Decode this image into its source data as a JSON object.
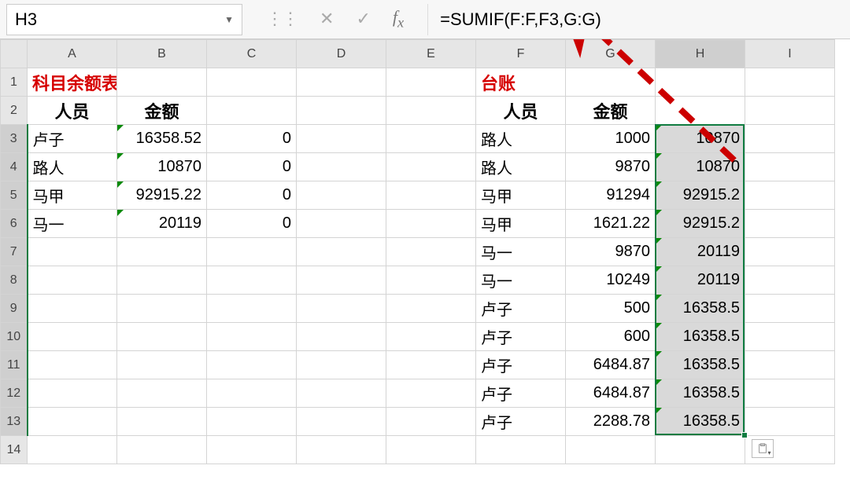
{
  "name_box": "H3",
  "formula": "=SUMIF(F:F,F3,G:G)",
  "columns": [
    "A",
    "B",
    "C",
    "D",
    "E",
    "F",
    "G",
    "H",
    "I"
  ],
  "rows": [
    "1",
    "2",
    "3",
    "4",
    "5",
    "6",
    "7",
    "8",
    "9",
    "10",
    "11",
    "12",
    "13",
    "14"
  ],
  "cells": {
    "A1": {
      "v": "科目余额表",
      "cls": "title-red left"
    },
    "F1": {
      "v": "台账",
      "cls": "title-red left"
    },
    "A2": {
      "v": "人员",
      "cls": "hdr-bold center"
    },
    "B2": {
      "v": "金额",
      "cls": "hdr-bold center"
    },
    "F2": {
      "v": "人员",
      "cls": "hdr-bold center"
    },
    "G2": {
      "v": "金额",
      "cls": "hdr-bold center"
    },
    "A3": {
      "v": "卢子",
      "cls": "left"
    },
    "B3": {
      "v": "16358.52",
      "cls": "right",
      "tri": true
    },
    "C3": {
      "v": "0",
      "cls": "right"
    },
    "F3": {
      "v": "路人",
      "cls": "left"
    },
    "G3": {
      "v": "1000",
      "cls": "right"
    },
    "H3": {
      "v": "10870",
      "cls": "right sel-col",
      "tri": true
    },
    "A4": {
      "v": "路人",
      "cls": "left"
    },
    "B4": {
      "v": "10870",
      "cls": "right",
      "tri": true
    },
    "C4": {
      "v": "0",
      "cls": "right"
    },
    "F4": {
      "v": "路人",
      "cls": "left"
    },
    "G4": {
      "v": "9870",
      "cls": "right"
    },
    "H4": {
      "v": "10870",
      "cls": "right sel-col",
      "tri": true
    },
    "A5": {
      "v": "马甲",
      "cls": "left"
    },
    "B5": {
      "v": "92915.22",
      "cls": "right",
      "tri": true
    },
    "C5": {
      "v": "0",
      "cls": "right"
    },
    "F5": {
      "v": "马甲",
      "cls": "left"
    },
    "G5": {
      "v": "91294",
      "cls": "right"
    },
    "H5": {
      "v": "92915.2",
      "cls": "right sel-col",
      "tri": true
    },
    "A6": {
      "v": "马一",
      "cls": "left"
    },
    "B6": {
      "v": "20119",
      "cls": "right",
      "tri": true
    },
    "C6": {
      "v": "0",
      "cls": "right"
    },
    "F6": {
      "v": "马甲",
      "cls": "left"
    },
    "G6": {
      "v": "1621.22",
      "cls": "right"
    },
    "H6": {
      "v": "92915.2",
      "cls": "right sel-col",
      "tri": true
    },
    "F7": {
      "v": "马一",
      "cls": "left"
    },
    "G7": {
      "v": "9870",
      "cls": "right"
    },
    "H7": {
      "v": "20119",
      "cls": "right sel-col",
      "tri": true
    },
    "F8": {
      "v": "马一",
      "cls": "left"
    },
    "G8": {
      "v": "10249",
      "cls": "right"
    },
    "H8": {
      "v": "20119",
      "cls": "right sel-col",
      "tri": true
    },
    "F9": {
      "v": "卢子",
      "cls": "left"
    },
    "G9": {
      "v": "500",
      "cls": "right"
    },
    "H9": {
      "v": "16358.5",
      "cls": "right sel-col",
      "tri": true
    },
    "F10": {
      "v": "卢子",
      "cls": "left"
    },
    "G10": {
      "v": "600",
      "cls": "right"
    },
    "H10": {
      "v": "16358.5",
      "cls": "right sel-col",
      "tri": true
    },
    "F11": {
      "v": "卢子",
      "cls": "left"
    },
    "G11": {
      "v": "6484.87",
      "cls": "right"
    },
    "H11": {
      "v": "16358.5",
      "cls": "right sel-col",
      "tri": true
    },
    "F12": {
      "v": "卢子",
      "cls": "left"
    },
    "G12": {
      "v": "6484.87",
      "cls": "right"
    },
    "H12": {
      "v": "16358.5",
      "cls": "right sel-col",
      "tri": true
    },
    "F13": {
      "v": "卢子",
      "cls": "left"
    },
    "G13": {
      "v": "2288.78",
      "cls": "right"
    },
    "H13": {
      "v": "16358.5",
      "cls": "right sel-col",
      "tri": true
    }
  },
  "selection": {
    "col": "H",
    "start": 3,
    "end": 13
  },
  "arrow_color": "#cc0000"
}
